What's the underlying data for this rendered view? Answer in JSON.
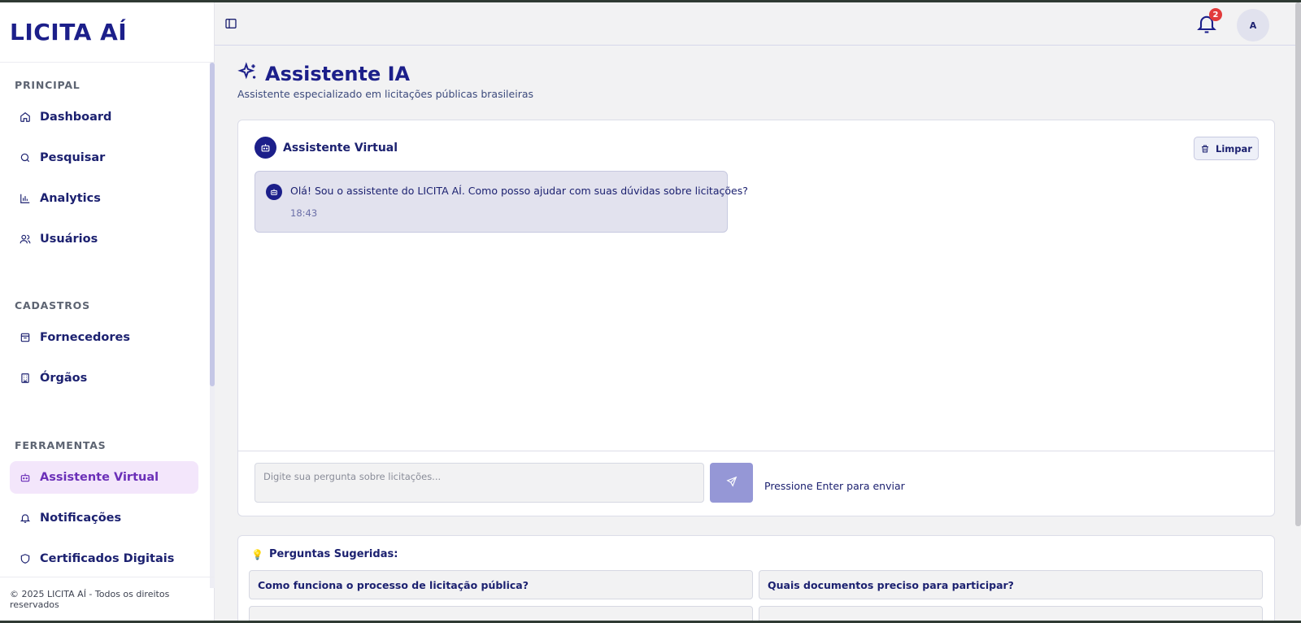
{
  "brand": {
    "name": "LICITA AÍ"
  },
  "sidebar": {
    "sections": [
      {
        "title": "PRINCIPAL",
        "items": [
          {
            "label": "Dashboard",
            "icon": "home-icon"
          },
          {
            "label": "Pesquisar",
            "icon": "search-icon"
          },
          {
            "label": "Analytics",
            "icon": "bar-chart-icon"
          },
          {
            "label": "Usuários",
            "icon": "users-icon"
          }
        ]
      },
      {
        "title": "CADASTROS",
        "items": [
          {
            "label": "Fornecedores",
            "icon": "package-icon"
          },
          {
            "label": "Órgãos",
            "icon": "building-icon"
          }
        ]
      },
      {
        "title": "FERRAMENTAS",
        "items": [
          {
            "label": "Assistente Virtual",
            "icon": "bot-icon",
            "active": true
          },
          {
            "label": "Notificações",
            "icon": "bell-icon"
          },
          {
            "label": "Certificados Digitais",
            "icon": "shield-icon"
          }
        ]
      }
    ],
    "footer": "© 2025 LICITA AÍ - Todos os direitos reservados"
  },
  "header": {
    "notifications_count": "2",
    "avatar_initial": "A"
  },
  "page": {
    "title": "Assistente IA",
    "subtitle": "Assistente especializado em licitações públicas brasileiras"
  },
  "chat": {
    "title": "Assistente Virtual",
    "clear_label": "Limpar",
    "messages": [
      {
        "text": "Olá! Sou o assistente do LICITA AÍ. Como posso ajudar com suas dúvidas sobre licitações?",
        "time": "18:43"
      }
    ],
    "input_placeholder": "Digite sua pergunta sobre licitações...",
    "hint": "Pressione Enter para enviar"
  },
  "suggestions": {
    "title": "Perguntas Sugeridas:",
    "items": [
      "Como funciona o processo de licitação pública?",
      "Quais documentos preciso para participar?",
      "",
      ""
    ]
  },
  "colors": {
    "brand": "#1c1f8a",
    "active_bg": "#f3e6fb",
    "active_text": "#6b2fb8",
    "send_button": "#9597d6",
    "badge": "#e23b3b"
  }
}
